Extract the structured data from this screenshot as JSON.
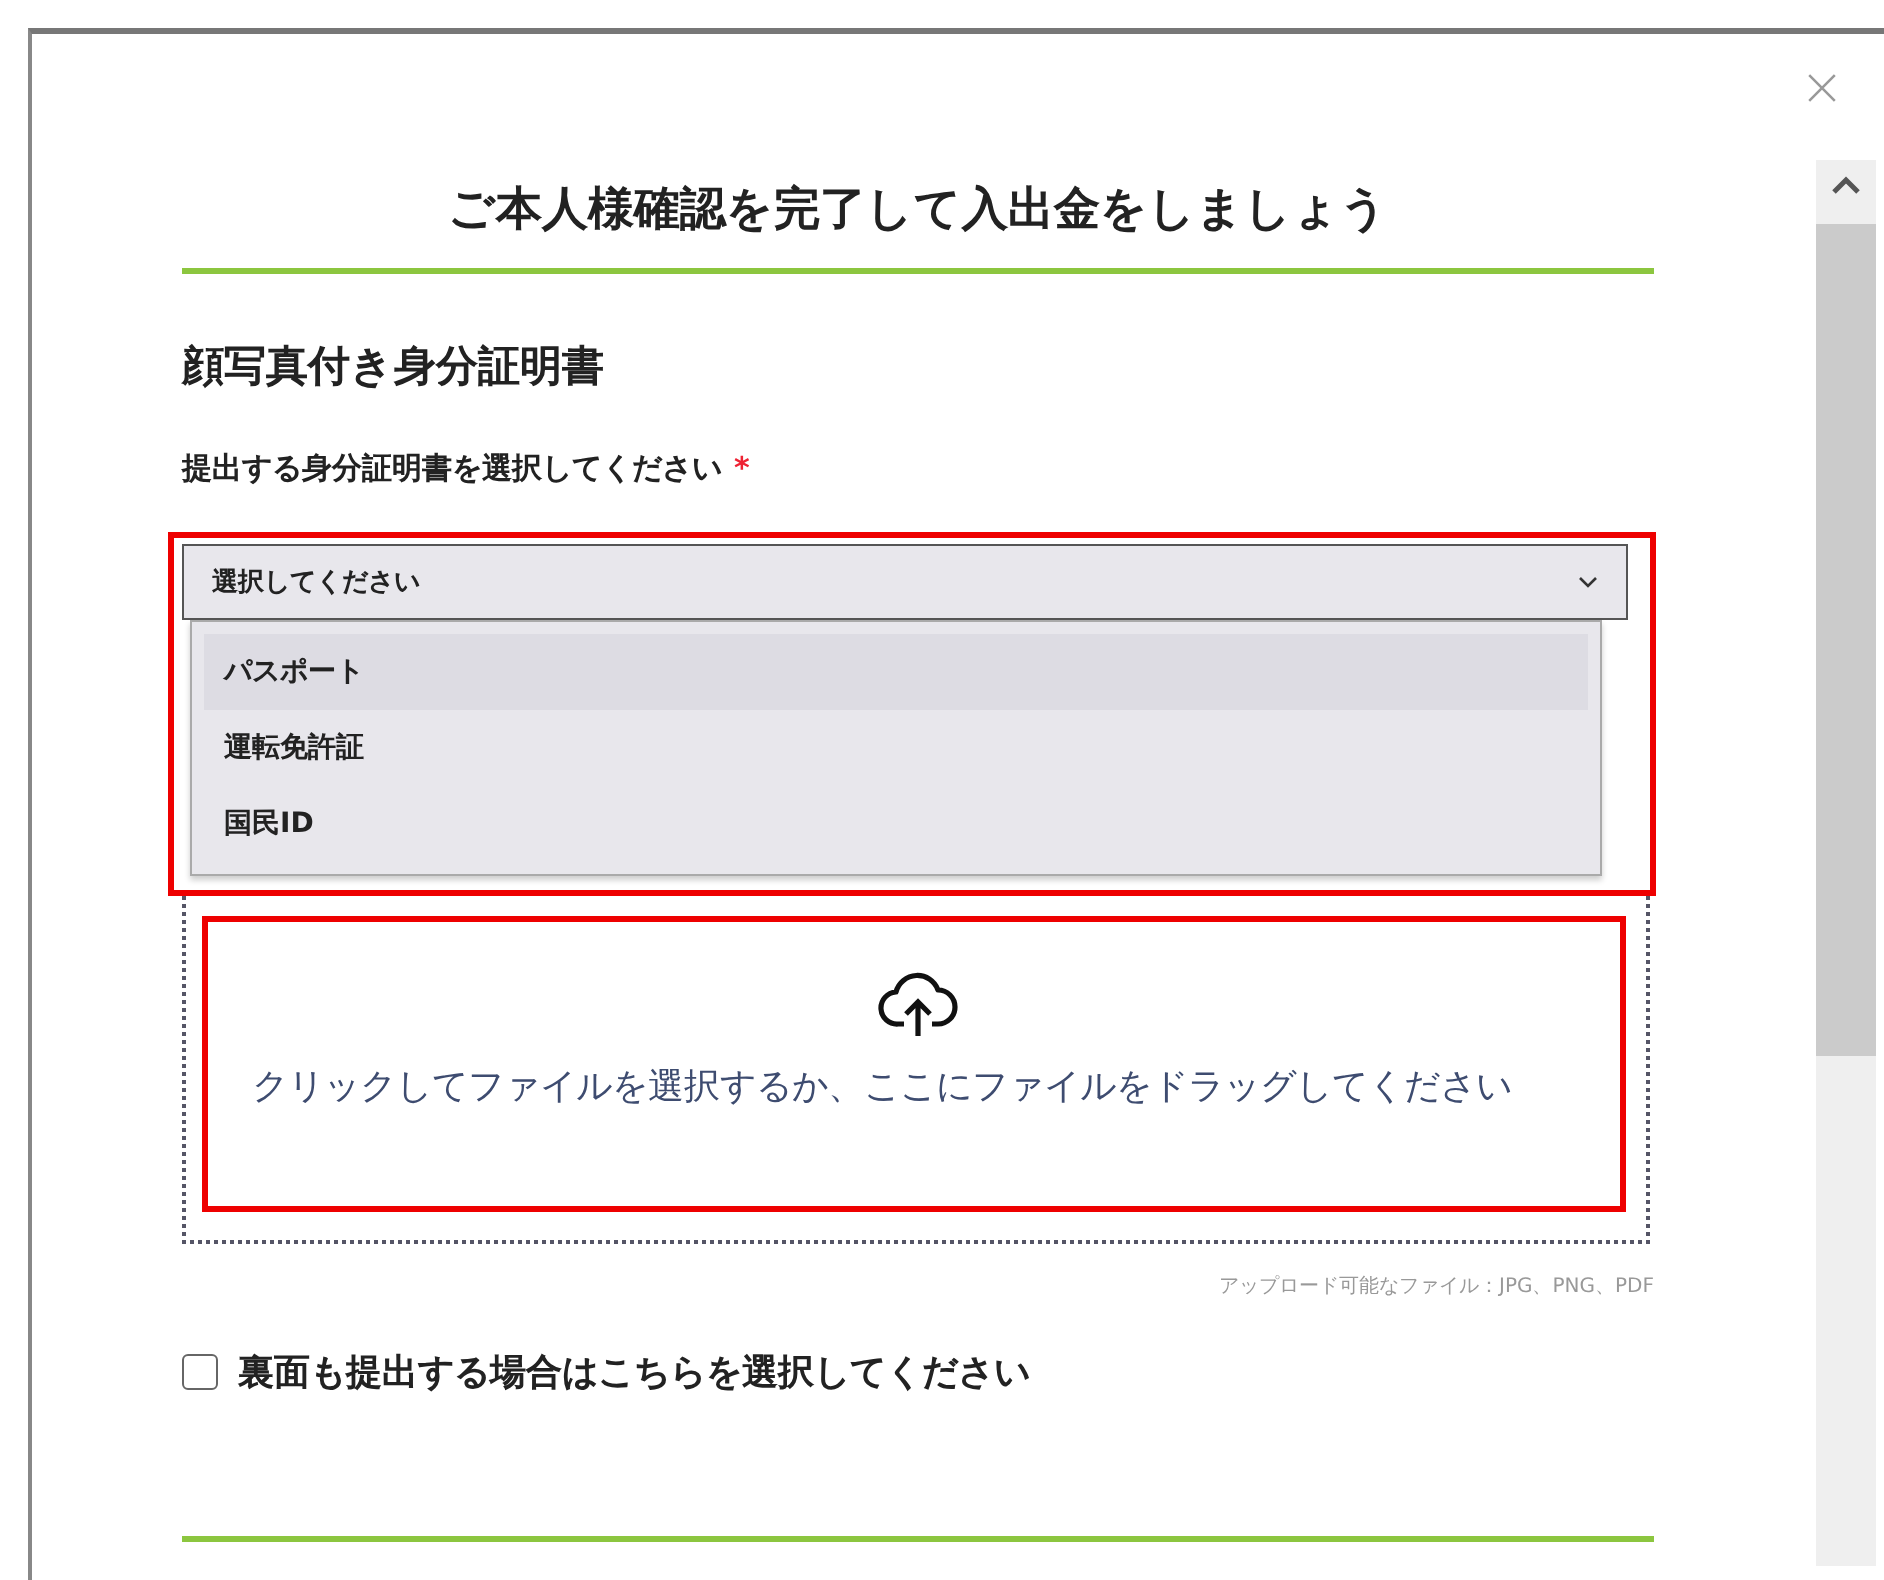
{
  "dialog": {
    "title": "ご本人様確認を完了して入出金をしましょう"
  },
  "section": {
    "heading": "顔写真付き身分証明書",
    "field_label": "提出する身分証明書を選択してください",
    "required_marker": "*",
    "select": {
      "value": "選択してください",
      "expanded": true,
      "options": [
        {
          "label": "パスポート",
          "selected": true
        },
        {
          "label": "運転免許証",
          "selected": false
        },
        {
          "label": "国民ID",
          "selected": false
        }
      ]
    },
    "upload": {
      "text": "クリックしてファイルを選択するか、ここにファイルをドラッグしてください",
      "hint": "アップロード可能なファイル：JPG、PNG、PDF"
    },
    "back_side": {
      "label": "裏面も提出する場合はこちらを選択してください",
      "checked": false
    }
  }
}
